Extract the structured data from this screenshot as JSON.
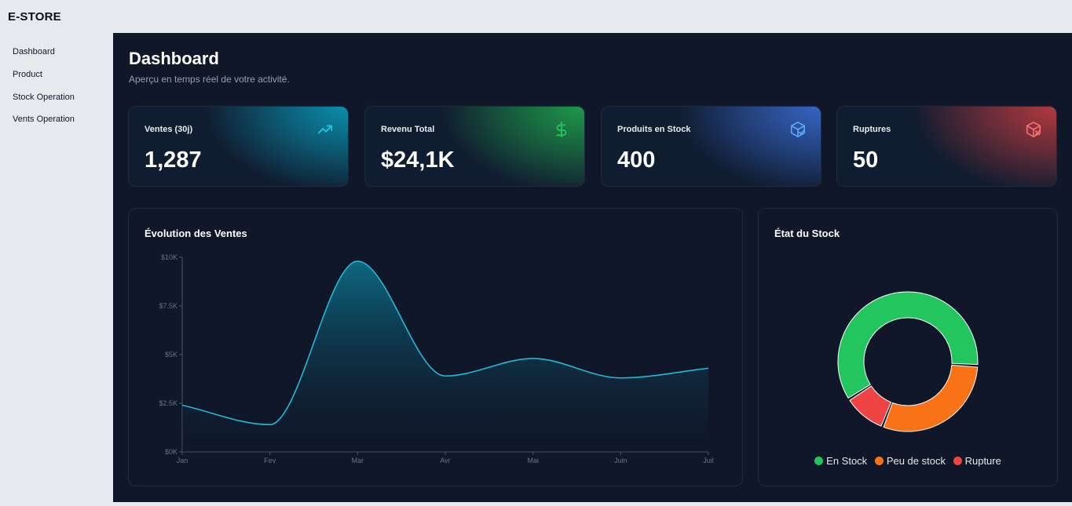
{
  "app": {
    "brand": "E-STORE"
  },
  "sidebar": {
    "items": [
      {
        "label": "Dashboard"
      },
      {
        "label": "Product"
      },
      {
        "label": "Stock Operation"
      },
      {
        "label": "Vents Operation"
      }
    ]
  },
  "header": {
    "title": "Dashboard",
    "subtitle": "Aperçu en temps réel de votre activité."
  },
  "kpis": [
    {
      "label": "Ventes (30j)",
      "value": "1,287",
      "icon": "trending-up-icon",
      "color": "#22c5e0"
    },
    {
      "label": "Revenu Total",
      "value": "$24,1K",
      "icon": "dollar-icon",
      "color": "#22c55e"
    },
    {
      "label": "Produits en Stock",
      "value": "400",
      "icon": "package-check-icon",
      "color": "#60a5fa"
    },
    {
      "label": "Ruptures",
      "value": "50",
      "icon": "package-x-icon",
      "color": "#f87171"
    }
  ],
  "sales_chart": {
    "title": "Évolution des Ventes"
  },
  "stock_chart": {
    "title": "État du Stock"
  },
  "chart_data": [
    {
      "type": "area",
      "title": "Évolution des Ventes",
      "categories": [
        "Jan",
        "Fev",
        "Mar",
        "Avr",
        "Mai",
        "Juin",
        "Juil"
      ],
      "values": [
        2400,
        1400,
        9800,
        3900,
        4800,
        3800,
        4300
      ],
      "yticks": [
        "$0K",
        "$2.5K",
        "$5K",
        "$7.5K",
        "$10K"
      ],
      "ylim": [
        0,
        10000
      ],
      "grid": false,
      "color": "#22b8d6"
    },
    {
      "type": "pie",
      "title": "État du Stock",
      "categories": [
        "En Stock",
        "Peu de stock",
        "Rupture"
      ],
      "values": [
        60,
        30,
        10
      ],
      "colors": [
        "#22c55e",
        "#f97316",
        "#ef4444"
      ],
      "legend": "bottom"
    }
  ]
}
